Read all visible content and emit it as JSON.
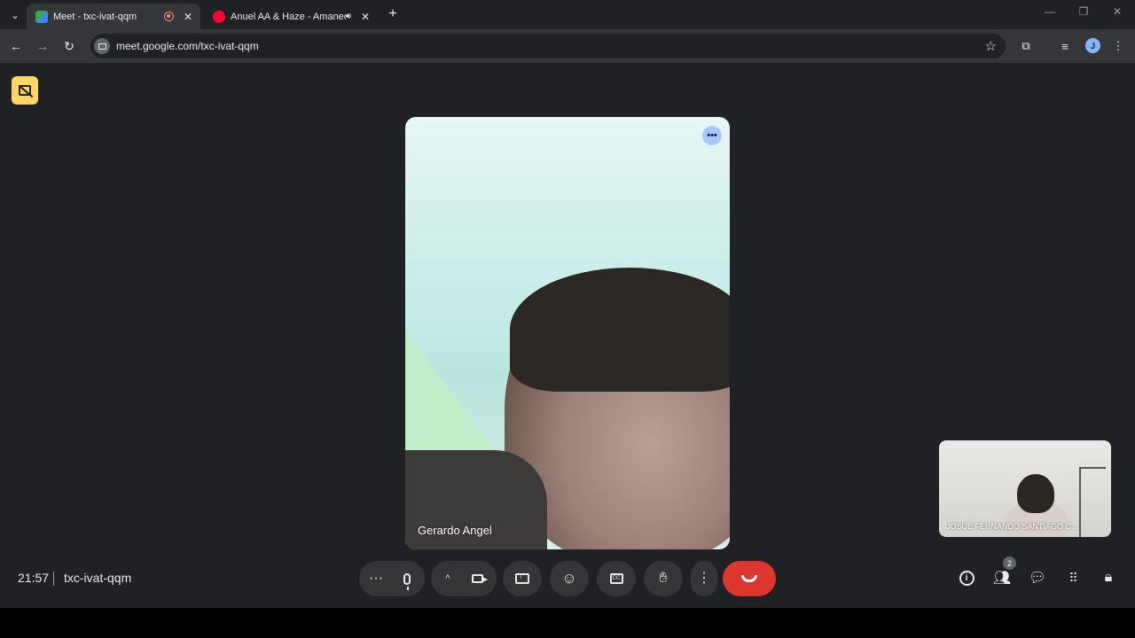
{
  "browser": {
    "tabs": [
      {
        "title": "Meet - txc-ivat-qqm",
        "favicon_color": "#34a853",
        "active": true,
        "recording": true
      },
      {
        "title": "Anuel AA & Haze - Amanec",
        "favicon_color": "#ff0033",
        "active": false,
        "audio": true
      }
    ],
    "url": "meet.google.com/txc-ivat-qqm",
    "profile_initial": "J"
  },
  "meet": {
    "main_participant": "Gerardo Angel",
    "self_participant": "JOSUE FERNANDO SANTIAGO C...",
    "clock": "21:57",
    "meeting_code": "txc-ivat-qqm",
    "people_count": "2",
    "end_call_color": "#dc362e",
    "warning_badge_color": "#fdd663"
  }
}
